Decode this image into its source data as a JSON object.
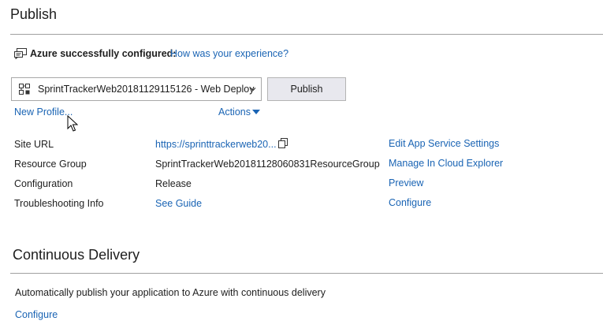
{
  "publish": {
    "title": "Publish",
    "notice": {
      "icon": "feedback-icon",
      "status": "Azure successfully configured:",
      "feedback_link": "How was your experience?"
    },
    "profile": {
      "icon": "web-deploy-icon",
      "selected": "SprintTrackerWeb20181129115126 - Web Deploy"
    },
    "publish_button": "Publish",
    "new_profile_link": "New Profile...",
    "actions_link": "Actions",
    "details": [
      {
        "label": "Site URL",
        "value": "https://sprinttrackerweb20...",
        "value_is_link": true
      },
      {
        "label": "Resource Group",
        "value": "SprintTrackerWeb20181128060831ResourceGroup",
        "value_is_link": false
      },
      {
        "label": "Configuration",
        "value": "Release",
        "value_is_link": false
      },
      {
        "label": "Troubleshooting Info",
        "value": "See Guide",
        "value_is_link": true
      }
    ],
    "side_links": [
      "Edit App Service Settings",
      "Manage In Cloud Explorer",
      "Preview",
      "Configure"
    ]
  },
  "continuous_delivery": {
    "title": "Continuous Delivery",
    "description": "Automatically publish your application to Azure with continuous delivery",
    "configure_link": "Configure"
  },
  "colors": {
    "link": "#1a64b4",
    "text": "#1e1e1e",
    "button_bg": "#e8e8ee"
  }
}
